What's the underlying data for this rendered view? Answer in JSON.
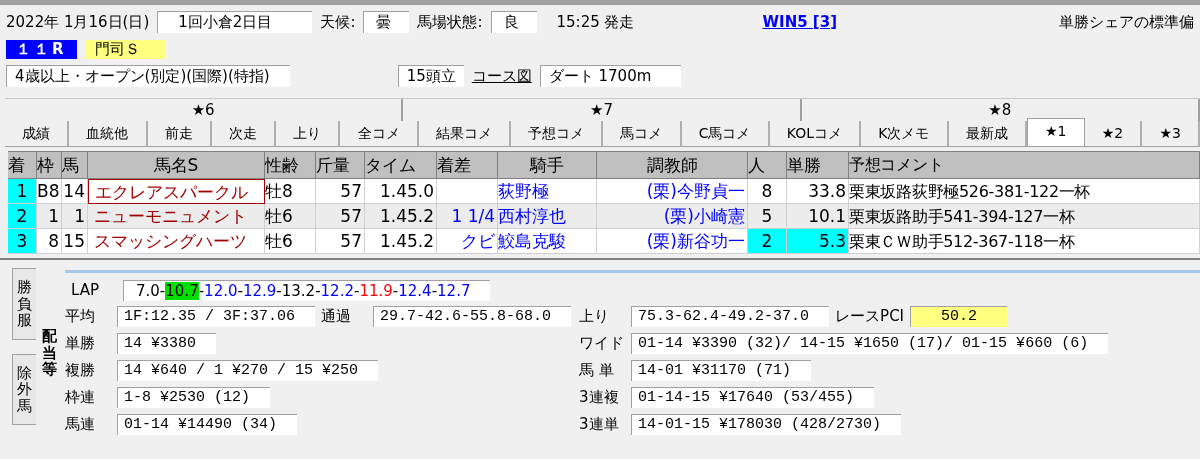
{
  "race_header": {
    "date": "2022年 1月16日(日)",
    "meeting": "1回小倉2日目",
    "weather_label": "天候:",
    "weather": "曇",
    "track_label": "馬場状態:",
    "track": "良",
    "post_time": "15:25 発走",
    "win5_link": "WIN5 [3]",
    "share_label": "単勝シェアの標準偏",
    "race_number": "１１R",
    "race_name": "門司Ｓ",
    "conditions": "4歳以上・オープン(別定)(国際)(特指)",
    "runners": "15頭立",
    "course_link": "コース図",
    "course": "ダート 1700m"
  },
  "tab_groups": [
    {
      "label": "★6"
    },
    {
      "label": "★7"
    },
    {
      "label": "★8"
    }
  ],
  "tabs": [
    {
      "label": "成績",
      "selected": false
    },
    {
      "label": "血統他",
      "selected": false
    },
    {
      "label": "前走",
      "selected": false
    },
    {
      "label": "次走",
      "selected": false
    },
    {
      "label": "上り",
      "selected": false
    },
    {
      "label": "全コメ",
      "selected": false
    },
    {
      "label": "結果コメ",
      "selected": false
    },
    {
      "label": "予想コメ",
      "selected": false
    },
    {
      "label": "馬コメ",
      "selected": false
    },
    {
      "label": "C馬コメ",
      "selected": false
    },
    {
      "label": "KOLコメ",
      "selected": false
    },
    {
      "label": "K次メモ",
      "selected": false
    },
    {
      "label": "最新成",
      "selected": false
    },
    {
      "label": "★1",
      "selected": true
    },
    {
      "label": "★2",
      "selected": false
    },
    {
      "label": "★3",
      "selected": false
    }
  ],
  "table": {
    "columns": [
      "着",
      "枠",
      "馬",
      "馬名S",
      "性齢",
      "斤量",
      "タイム",
      "着差",
      "騎手",
      "調教師",
      "人",
      "単勝",
      "予想コメント"
    ],
    "rows": [
      {
        "cells": [
          "1",
          "B8",
          "14",
          "エクレアスパークル",
          "牡8",
          "57",
          "1.45.0",
          null,
          "荻野極",
          "(栗)今野貞一",
          "8",
          "33.8",
          "栗東坂路荻野極526-381-122一杯"
        ],
        "focused": true,
        "favorite": false
      },
      {
        "cells": [
          "2",
          "1",
          "1",
          "ニューモニュメント",
          "牡6",
          "57",
          "1.45.2",
          "1 1/4",
          "西村淳也",
          "(栗)小崎憲",
          "5",
          "10.1",
          "栗東坂路助手541-394-127一杯"
        ],
        "focused": false,
        "favorite": false
      },
      {
        "cells": [
          "3",
          "8",
          "15",
          "スマッシングハーツ",
          "牡6",
          "57",
          "1.45.2",
          "クビ",
          "鮫島克駿",
          "(栗)新谷功一",
          "2",
          "5.3",
          "栗東ＣＷ助手512-367-118一杯"
        ],
        "focused": false,
        "favorite": true
      }
    ]
  },
  "side_tabs": [
    {
      "label": "勝負服",
      "selected": false
    },
    {
      "label": "除外馬",
      "selected": false
    },
    {
      "label": "配当等",
      "selected": true
    }
  ],
  "lap": {
    "label": "LAP",
    "segments": [
      {
        "text": "7.0-",
        "color": "#000000",
        "highlight": false
      },
      {
        "text": "10.7",
        "highlight": true
      },
      {
        "text": "-",
        "color": "#000000",
        "highlight": false
      },
      {
        "text": "12.0",
        "color": "#0000ff",
        "highlight": false
      },
      {
        "text": "-",
        "color": "#000000",
        "highlight": false
      },
      {
        "text": "12.9",
        "color": "#0000ff",
        "highlight": false
      },
      {
        "text": "-13.2-",
        "color": "#000000",
        "highlight": false
      },
      {
        "text": "12.2",
        "color": "#0000ff",
        "highlight": false
      },
      {
        "text": "-",
        "color": "#000000",
        "highlight": false
      },
      {
        "text": "11.9",
        "color": "#ff0000",
        "highlight": false
      },
      {
        "text": "-",
        "color": "#000000",
        "highlight": false
      },
      {
        "text": "12.4",
        "color": "#0000ff",
        "highlight": false
      },
      {
        "text": "-",
        "color": "#000000",
        "highlight": false
      },
      {
        "text": "12.7",
        "color": "#0000ff",
        "highlight": false
      }
    ]
  },
  "stats_left": [
    {
      "label": "平均",
      "value": "1F:12.35 / 3F:37.06"
    },
    {
      "label": "通過",
      "value": "29.7-42.6-55.8-68.0"
    }
  ],
  "stats_right": [
    {
      "label": "上り",
      "value": "75.3-62.4-49.2-37.0"
    },
    {
      "label": "レースPCI",
      "value": "50.2",
      "kind": "pci"
    }
  ],
  "payouts_left": [
    {
      "label": "単勝",
      "value": "14 ¥3380"
    },
    {
      "label": "複勝",
      "value": "14 ¥640 /  1 ¥270 / 15 ¥250"
    },
    {
      "label": "枠連",
      "value": "1-8 ¥2530 (12)"
    },
    {
      "label": "馬連",
      "value": "01-14 ¥14490 (34)"
    }
  ],
  "payouts_right": [
    {
      "label": "ワイド",
      "value": "01-14 ¥3390 (32)/ 14-15 ¥1650 (17)/ 01-15 ¥660 (6)"
    },
    {
      "label": "馬 単",
      "value": "14-01 ¥31170 (71)"
    },
    {
      "label": "3連複",
      "value": "01-14-15 ¥17640 (53/455)"
    },
    {
      "label": "3連単",
      "value": "14-01-15 ¥178030 (428/2730)"
    }
  ]
}
